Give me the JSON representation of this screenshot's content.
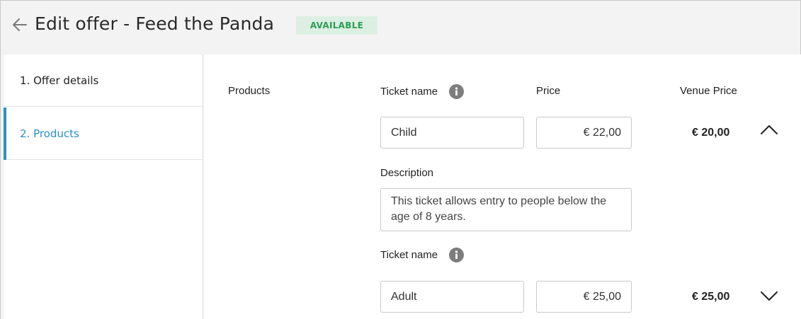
{
  "header": {
    "title": "Edit offer - Feed the Panda",
    "status_badge": "AVAILABLE"
  },
  "sidebar": {
    "items": [
      {
        "label": "1. Offer details",
        "active": false
      },
      {
        "label": "2. Products",
        "active": true
      }
    ]
  },
  "main": {
    "section_label": "Products",
    "columns": {
      "ticket_name": "Ticket name",
      "price": "Price",
      "venue_price": "Venue Price"
    },
    "products": [
      {
        "ticket_name_label": "Ticket name",
        "name": "Child",
        "price": "€ 22,00",
        "venue_price": "€ 20,00",
        "expanded": true,
        "description_label": "Description",
        "description": "This ticket allows entry to people below the age of 8 years."
      },
      {
        "ticket_name_label": "Ticket name",
        "name": "Adult",
        "price": "€ 25,00",
        "venue_price": "€ 25,00",
        "expanded": false
      }
    ]
  },
  "colors": {
    "accent": "#2a90c8",
    "badge_bg": "#dcefe3",
    "badge_text": "#2e9e55"
  },
  "icons": {
    "back": "arrow-left-icon",
    "info": "info-icon",
    "collapse": "chevron-up-icon",
    "expand": "chevron-down-icon"
  }
}
